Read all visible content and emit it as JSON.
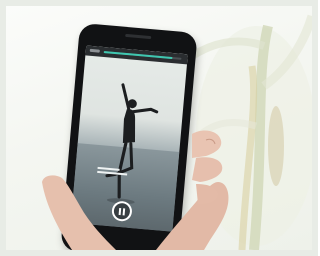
{
  "photo": {
    "video": {
      "progress_fraction": 0.88
    }
  }
}
